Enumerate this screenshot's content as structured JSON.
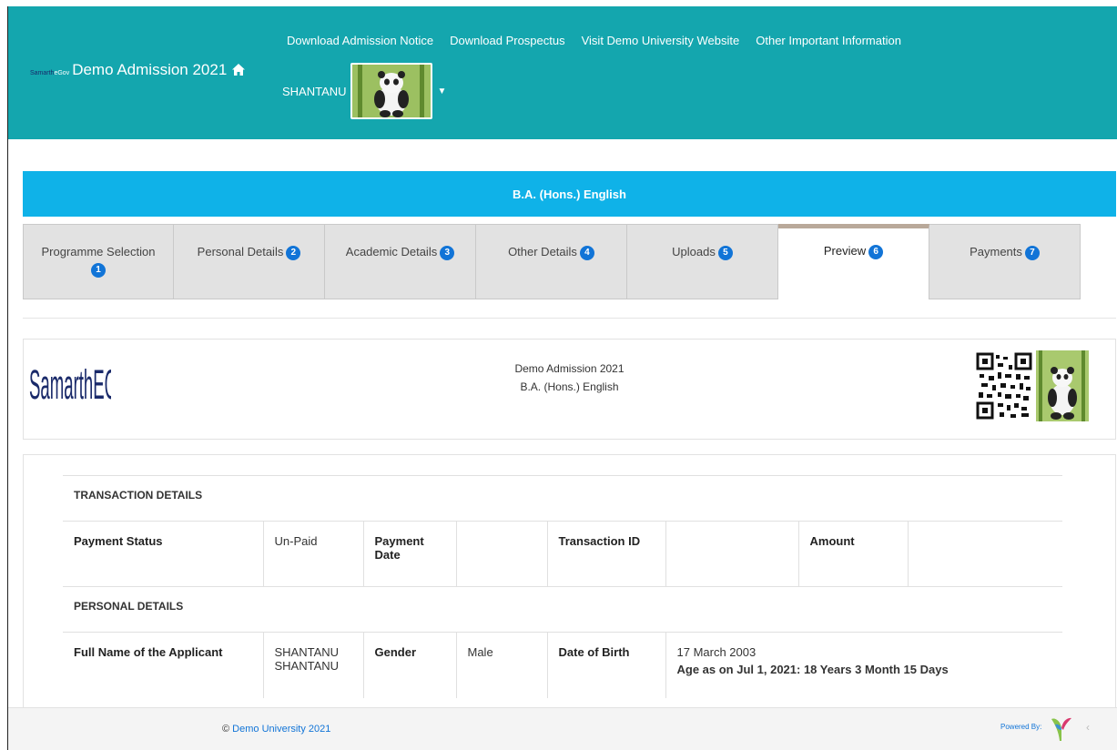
{
  "navbar": {
    "brand_small": "Samarth",
    "brand_small_egov": "eGov",
    "brand_title": "Demo Admission 2021",
    "links": [
      "Download Admission Notice",
      "Download Prospectus",
      "Visit Demo University Website",
      "Other Important Information"
    ],
    "user_name": "SHANTANU",
    "colors": {
      "bar": "#14a6ae"
    }
  },
  "programme": {
    "banner": "B.A. (Hons.) English"
  },
  "tabs": [
    {
      "label": "Programme Selection",
      "badge": "1"
    },
    {
      "label": "Personal Details",
      "badge": "2"
    },
    {
      "label": "Academic Details",
      "badge": "3"
    },
    {
      "label": "Other Details",
      "badge": "4"
    },
    {
      "label": "Uploads",
      "badge": "5"
    },
    {
      "label": "Preview",
      "badge": "6",
      "active": true
    },
    {
      "label": "Payments",
      "badge": "7"
    }
  ],
  "preview": {
    "logo_text": "SamarthEGov",
    "title_line1": "Demo Admission 2021",
    "title_line2": "B.A. (Hons.) English"
  },
  "transaction": {
    "section": "TRANSACTION DETAILS",
    "payment_status_label": "Payment Status",
    "payment_status_value": "Un-Paid",
    "payment_date_label": "Payment Date",
    "payment_date_value": "",
    "transaction_id_label": "Transaction ID",
    "transaction_id_value": "",
    "amount_label": "Amount",
    "amount_value": ""
  },
  "personal": {
    "section": "PERSONAL DETAILS",
    "full_name_label": "Full Name of the Applicant",
    "full_name_value": "SHANTANU SHANTANU",
    "gender_label": "Gender",
    "gender_value": "Male",
    "dob_label": "Date of Birth",
    "dob_value": "17 March 2003",
    "age_text": "Age as on Jul 1, 2021: 18 Years 3 Month 15 Days"
  },
  "footer": {
    "copyright_symbol": "©",
    "copyright_link": "Demo University 2021",
    "powered_by": "Powered By:"
  }
}
